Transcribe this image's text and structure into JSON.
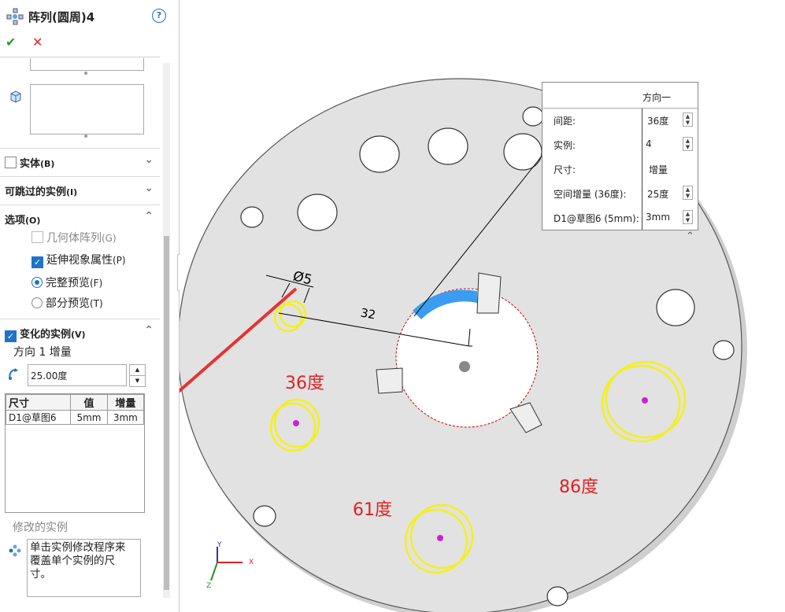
{
  "feature": {
    "title": "阵列(圆周)4",
    "help": "?"
  },
  "confirm": {
    "ok": "✔",
    "cancel": "✕"
  },
  "sections": {
    "bodies": "实体",
    "bodies_key": "(B)",
    "skip": "可跳过的实例",
    "skip_key": "(I)",
    "options": "选项",
    "options_key": "(O)",
    "varied": "变化的实例",
    "varied_key": "(V)"
  },
  "options": {
    "geometry": "几何体阵列",
    "geometry_key": "(G)",
    "propagate": "延伸视象属性",
    "propagate_key": "(P)",
    "full": "完整预览",
    "full_key": "(F)",
    "partial": "部分预览",
    "partial_key": "(T)"
  },
  "varied": {
    "dir_label": "方向 1 增量",
    "angle_value": "25.00度",
    "columns": [
      "尺寸",
      "值",
      "增量"
    ],
    "rows": [
      [
        "D1@草图6",
        "5mm",
        "3mm"
      ]
    ],
    "modified": "修改的实例",
    "hint": "单击实例修改程序来覆盖单个实例的尺寸。"
  },
  "popup": {
    "header": "方向一",
    "rows": [
      {
        "label": "间距:",
        "value": "36度",
        "spin": true
      },
      {
        "label": "实例:",
        "value": "4",
        "spin": true
      },
      {
        "label": "尺寸:",
        "value": "增量",
        "spin": false
      },
      {
        "label": "空间增量 (36度):",
        "value": "25度",
        "spin": true
      },
      {
        "label": "D1@草图6 (5mm):",
        "value": "3mm",
        "spin": true
      }
    ]
  },
  "annotations": {
    "a1": "36度",
    "a2": "61度",
    "a3": "86度",
    "diameter": "Ø5",
    "length": "32"
  },
  "triad": {
    "x": "X",
    "y": "Y",
    "z": "Z"
  },
  "colors": {
    "accent": "#1f73c8",
    "red": "#dd2222",
    "yellow": "#f2f020",
    "magenta": "#cc22cc",
    "part": "#e3e3e3"
  }
}
